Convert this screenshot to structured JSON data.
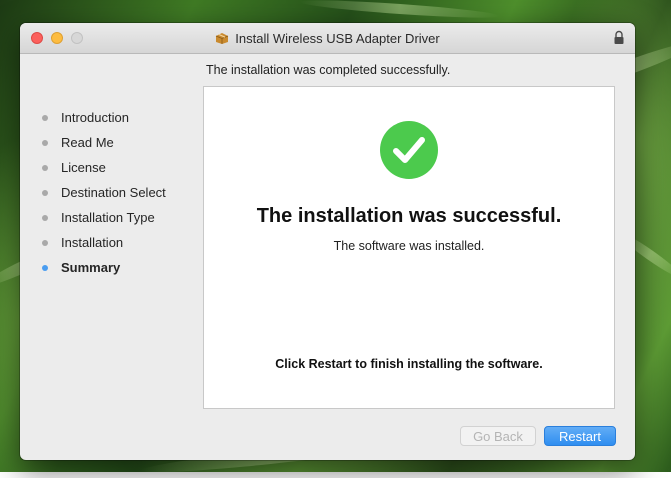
{
  "window": {
    "title": "Install Wireless USB Adapter Driver"
  },
  "header": {
    "status_text": "The installation was completed successfully."
  },
  "steps": [
    {
      "label": "Introduction",
      "current": false
    },
    {
      "label": "Read Me",
      "current": false
    },
    {
      "label": "License",
      "current": false
    },
    {
      "label": "Destination Select",
      "current": false
    },
    {
      "label": "Installation Type",
      "current": false
    },
    {
      "label": "Installation",
      "current": false
    },
    {
      "label": "Summary",
      "current": true
    }
  ],
  "content": {
    "heading": "The installation was successful.",
    "subtext": "The software was installed.",
    "restart_note": "Click Restart to finish installing the software."
  },
  "buttons": {
    "go_back": {
      "label": "Go Back",
      "enabled": false
    },
    "restart": {
      "label": "Restart",
      "enabled": true
    }
  },
  "colors": {
    "success_green": "#4cca4d",
    "current_step_blue": "#4a9df0",
    "primary_button_blue": "#3a94f2"
  },
  "icons": {
    "titlebar": "package-icon",
    "lock": "lock-icon",
    "status": "checkmark-icon"
  }
}
